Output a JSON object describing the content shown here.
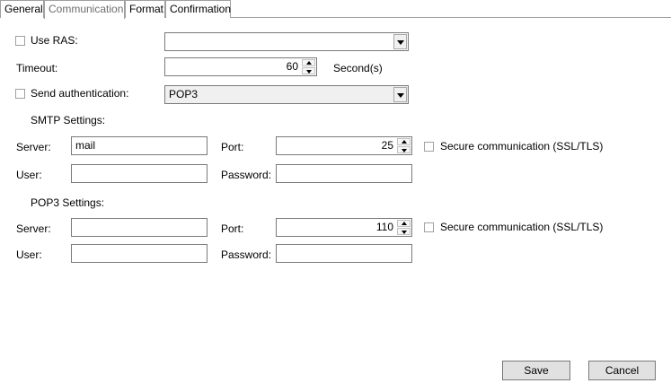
{
  "tabs": [
    "General",
    "Communication",
    "Format",
    "Confirmation"
  ],
  "active_tab": "Communication",
  "use_ras": {
    "label": "Use RAS:",
    "checked": false,
    "value": ""
  },
  "timeout": {
    "label": "Timeout:",
    "value": "60",
    "unit": "Second(s)"
  },
  "send_auth": {
    "label": "Send authentication:",
    "checked": false,
    "value": "POP3"
  },
  "smtp": {
    "title": "SMTP Settings:",
    "server_label": "Server:",
    "server_value": "mail",
    "port_label": "Port:",
    "port_value": "25",
    "secure_label": "Secure communication (SSL/TLS)",
    "secure_checked": false,
    "user_label": "User:",
    "user_value": "",
    "password_label": "Password:",
    "password_value": ""
  },
  "pop3": {
    "title": "POP3 Settings:",
    "server_label": "Server:",
    "server_value": "",
    "port_label": "Port:",
    "port_value": "110",
    "secure_label": "Secure communication (SSL/TLS)",
    "secure_checked": false,
    "user_label": "User:",
    "user_value": "",
    "password_label": "Password:",
    "password_value": ""
  },
  "buttons": {
    "save": "Save",
    "cancel": "Cancel"
  }
}
